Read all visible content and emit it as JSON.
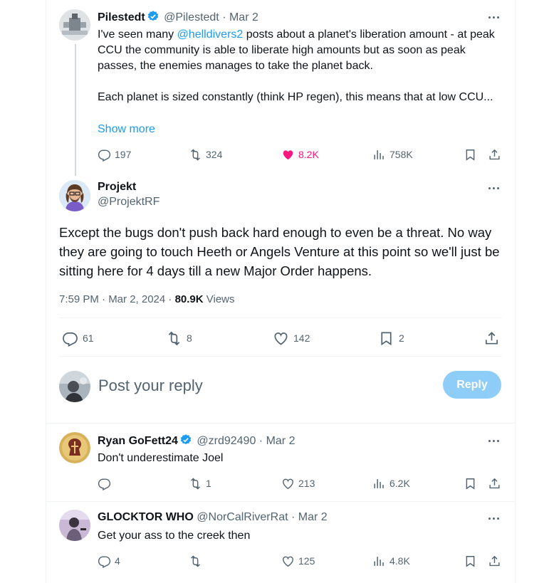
{
  "quoted_tweet": {
    "name": "Pilestedt",
    "handle": "@Pilestedt",
    "date": "· Mar 2",
    "text_before_link": "I've seen many ",
    "link": "@helldivers2",
    "text_after_link": " posts about a planet's liberation amount - at peak CCU the community is able to liberate high amounts but as soon as peak passes, the enemies manages to take the planet back.",
    "text_para2": "Each planet is sized constantly (think HP regen), this means that at low CCU...",
    "show_more": "Show more",
    "replies": "197",
    "reposts": "324",
    "likes": "8.2K",
    "views": "758K"
  },
  "main_tweet": {
    "name": "Projekt",
    "handle": "@ProjektRF",
    "text": "Except the bugs don't push back hard enough to even be a threat. No way they are going to touch Heeth or Angels Venture at this point so we'll just be sitting here for 4 days till a new Major Order happens.",
    "timestamp": "7:59 PM · Mar 2, 2024 · ",
    "views_count": "80.9K",
    "views_label": " Views",
    "replies": "61",
    "reposts": "8",
    "likes": "142",
    "bookmarks": "2"
  },
  "composer": {
    "placeholder": "Post your reply",
    "reply_button": "Reply"
  },
  "replies": [
    {
      "name": "Ryan GoFett24",
      "handle": "@zrd92490",
      "date": "· Mar 2",
      "text": "Don't underestimate Joel",
      "replies": "",
      "reposts": "1",
      "likes": "213",
      "views": "6.2K"
    },
    {
      "name": "GLOCKTOR WHO",
      "handle": "@NorCalRiverRat",
      "date": "· Mar 2",
      "text": "Get your ass to the creek then",
      "replies": "4",
      "reposts": "",
      "likes": "125",
      "views": "4.8K"
    }
  ],
  "colors": {
    "accent": "#1d9bf0",
    "like": "#f91880",
    "reply_button_disabled": "#8ecdf8"
  }
}
